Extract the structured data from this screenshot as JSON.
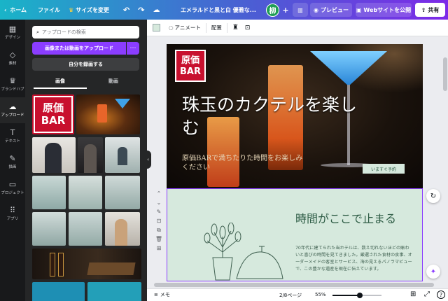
{
  "topbar": {
    "home_label": "ホーム",
    "file_label": "ファイル",
    "resize_label": "サイズを変更",
    "doc_title": "エメラルドと黒と白 優雅な...",
    "avatar_initial": "柳",
    "preview_label": "プレビュー",
    "publish_label": "Webサイトを公開",
    "share_label": "共有"
  },
  "rail": {
    "items": [
      {
        "label": "デザイン",
        "icon": "layout-icon"
      },
      {
        "label": "素材",
        "icon": "elements-icon"
      },
      {
        "label": "ブランドハブ",
        "icon": "brand-icon"
      },
      {
        "label": "アップロード",
        "icon": "upload-icon"
      },
      {
        "label": "テキスト",
        "icon": "text-icon"
      },
      {
        "label": "描画",
        "icon": "draw-icon"
      },
      {
        "label": "プロジェクト",
        "icon": "folder-icon"
      },
      {
        "label": "アプリ",
        "icon": "apps-icon"
      }
    ]
  },
  "panel": {
    "search_placeholder": "アップロードの検索",
    "upload_label": "画像または動画をアップロード",
    "record_label": "自分を録画する",
    "tabs": [
      "画像",
      "動画"
    ],
    "logo_line1": "原価",
    "logo_line2": "BAR"
  },
  "context": {
    "animate_label": "アニメート",
    "position_label": "配置"
  },
  "canvas": {
    "logo_line1": "原価",
    "logo_line2": "BAR",
    "hero_title": "珠玉のカクテルを楽しむ",
    "hero_sub": "原価BARで満ちたりた時間をお楽しみください",
    "reserve_label": "いますぐ予約",
    "section_title": "時間がここで止まる",
    "section_body": "70年代に建てられた当ホテルは、数え切れないほどの賑わいと喜びの時間を見てきました。厳選された食材の食事、オーダーメイドの客室とサービス、海の見えるパノラマビューで、この豊かな遺産を現在に伝えています。"
  },
  "bottombar": {
    "notes_label": "メモ",
    "page_label": "2/8ページ",
    "zoom_label": "55%",
    "zoom_fraction": 0.55
  },
  "colors": {
    "accent": "#8b3dff",
    "brand_red": "#c8102e",
    "section_bg": "#d6e9dd"
  }
}
